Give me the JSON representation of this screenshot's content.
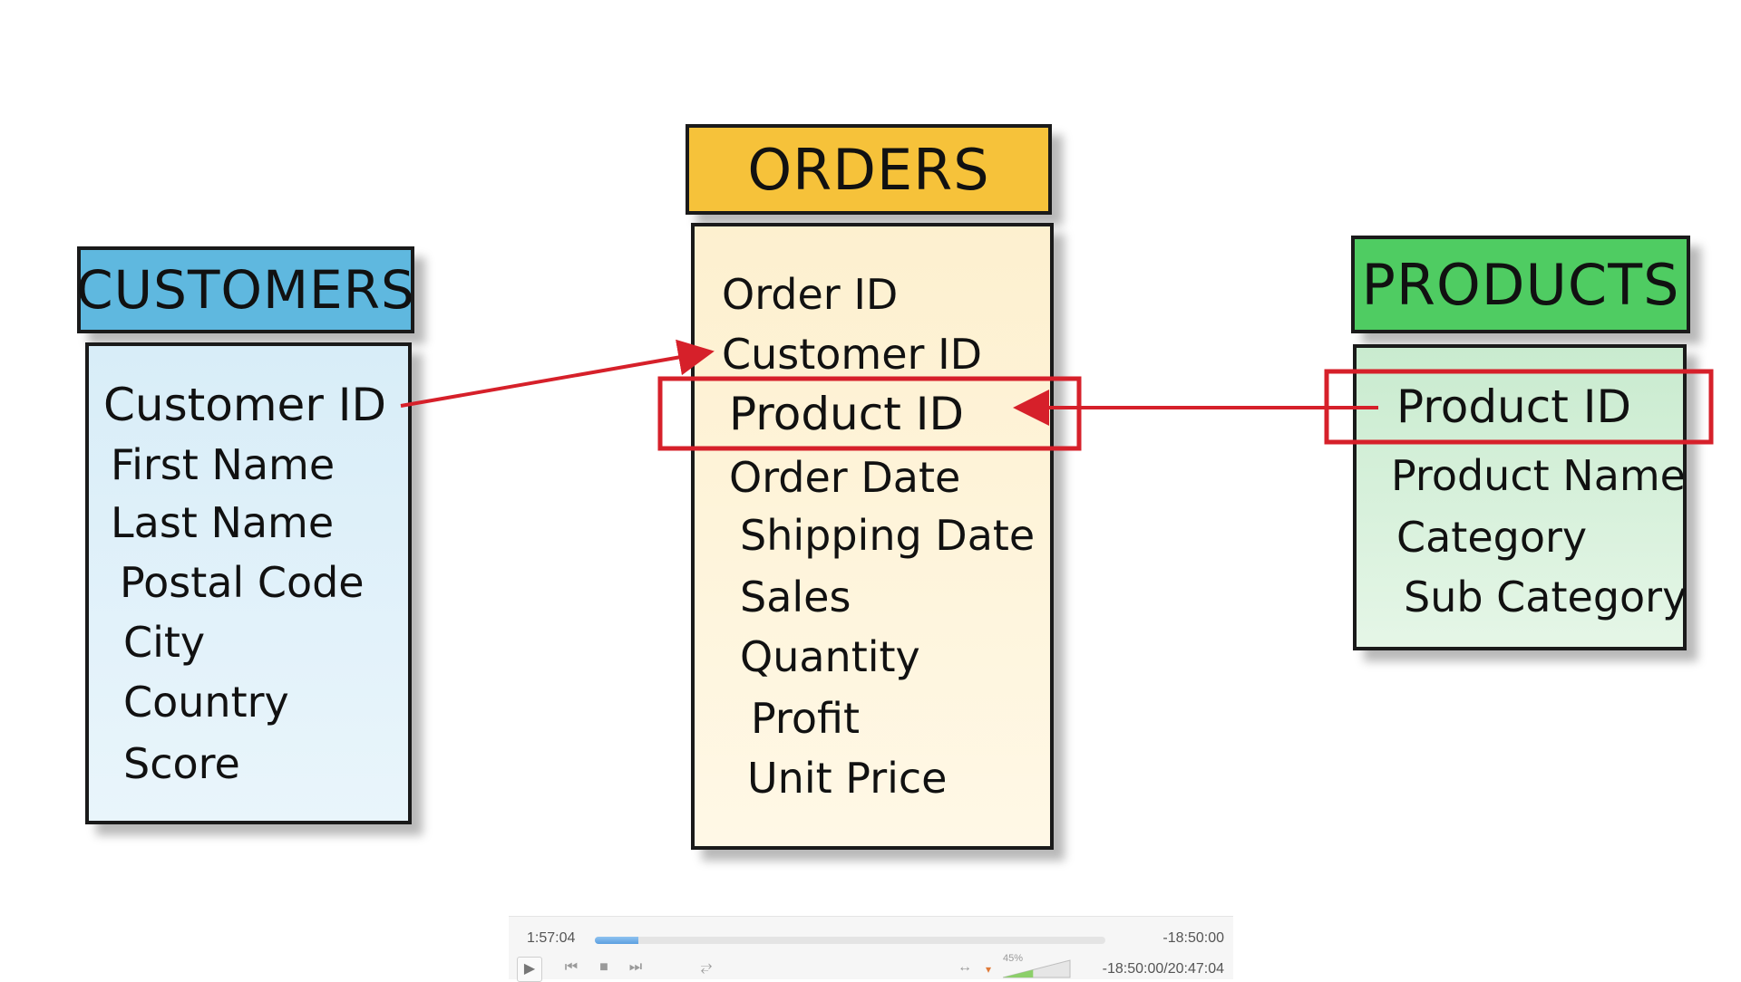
{
  "diagram": {
    "tables": [
      {
        "id": "customers",
        "title": "CUSTOMERS",
        "header_color": "#5fb8df",
        "body_color": "#d8edf8",
        "fields": [
          "Customer ID",
          "First Name",
          "Last Name",
          "Postal Code",
          "City",
          "Country",
          "Score"
        ]
      },
      {
        "id": "orders",
        "title": "ORDERS",
        "header_color": "#f6c23a",
        "body_color": "#fdf0cf",
        "fields": [
          "Order ID",
          "Customer ID",
          "Product ID",
          "Order Date",
          "Shipping Date",
          "Sales",
          "Quantity",
          "Profit",
          "Unit Price"
        ]
      },
      {
        "id": "products",
        "title": "PRODUCTS",
        "header_color": "#4fcc62",
        "body_color": "#c9ebcf",
        "fields": [
          "Product ID",
          "Product Name",
          "Category",
          "Sub Category"
        ]
      }
    ],
    "relationships": [
      {
        "from": "customers.Customer ID",
        "to": "orders.Customer ID"
      },
      {
        "from": "products.Product ID",
        "to": "orders.Product ID",
        "highlighted": true
      }
    ],
    "highlight_color": "#d6202a"
  },
  "player": {
    "elapsed": "1:57:04",
    "remaining": "-18:50:00",
    "progress_fraction": 0.085,
    "volume_percent": "45%",
    "time_total": "-18:50:00/20:47:04",
    "icons": [
      "play-icon",
      "previous-icon",
      "stop-icon",
      "next-icon",
      "fullscreen-icon",
      "aspect-ratio-icon",
      "volume-icon"
    ]
  }
}
